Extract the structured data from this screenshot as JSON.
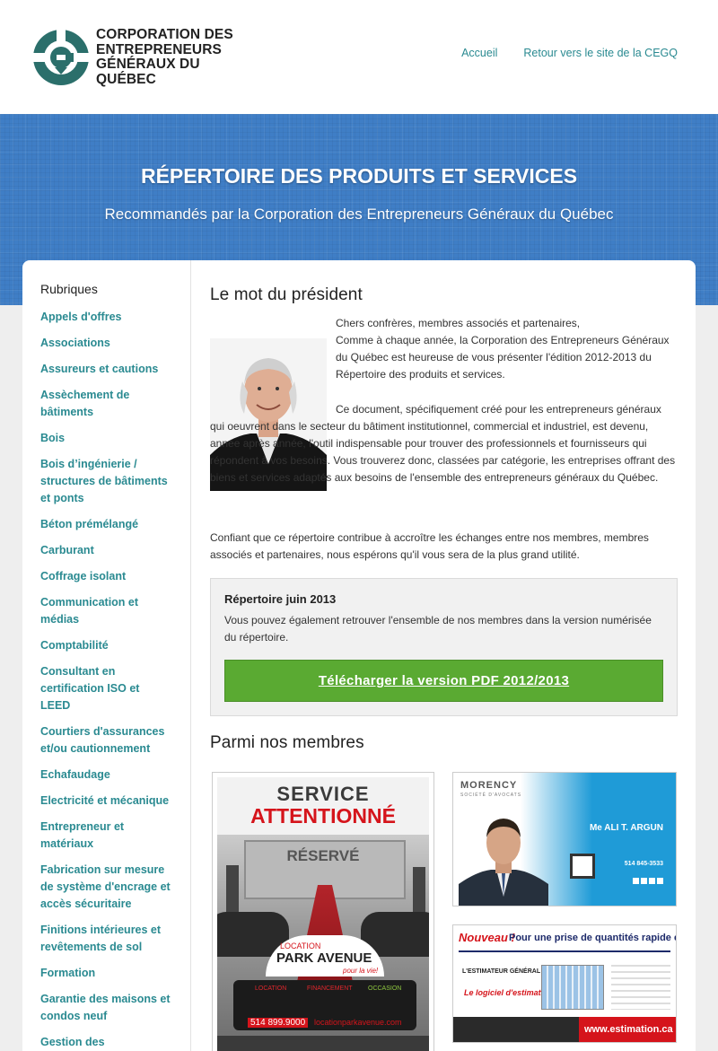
{
  "header": {
    "logo_lines": [
      "CORPORATION DES",
      "ENTREPRENEURS",
      "GÉNÉRAUX DU",
      "QUÉBEC"
    ],
    "nav": [
      {
        "label": "Accueil"
      },
      {
        "label": "Retour vers le site de la CEGQ"
      }
    ]
  },
  "banner": {
    "title": "RÉPERTOIRE DES PRODUITS ET SERVICES",
    "subtitle": "Recommandés par la Corporation des Entrepreneurs Généraux du Québec"
  },
  "sidebar": {
    "heading": "Rubriques",
    "items": [
      {
        "label": "Appels d'offres"
      },
      {
        "label": "Associations"
      },
      {
        "label": "Assureurs et cautions"
      },
      {
        "label": "Assèchement de bâtiments"
      },
      {
        "label": "Bois"
      },
      {
        "label": "Bois d’ingénierie / structures de bâtiments et ponts"
      },
      {
        "label": "Béton prémélangé"
      },
      {
        "label": "Carburant"
      },
      {
        "label": "Coffrage isolant"
      },
      {
        "label": "Communication et médias"
      },
      {
        "label": "Comptabilité"
      },
      {
        "label": "Consultant en certification ISO et LEED"
      },
      {
        "label": "Courtiers d'assurances et/ou cautionnement"
      },
      {
        "label": "Echafaudage"
      },
      {
        "label": "Electricité et mécanique"
      },
      {
        "label": "Entrepreneur et matériaux"
      },
      {
        "label": "Fabrication sur mesure de système d'encrage et accès sécuritaire"
      },
      {
        "label": "Finitions intérieures et revêtements de sol"
      },
      {
        "label": "Formation"
      },
      {
        "label": "Garantie des maisons et condos neuf"
      },
      {
        "label": "Gestion des"
      }
    ]
  },
  "main": {
    "president_title": "Le mot du président",
    "intro_lines": [
      "Chers confrères, membres associés et partenaires,",
      "Comme à chaque année, la Corporation des Entrepreneurs Généraux du Québec est heureuse de vous présenter l'édition 2012-2013 du Répertoire des produits et services."
    ],
    "body_text": "Ce document, spécifiquement créé pour les entrepreneurs généraux qui oeuvrent dans le secteur du bâtiment institutionnel, commercial et industriel, est devenu, année après année, l'outil indispensable pour trouver des professionnels et fournisseurs qui répondent à vos besoins. Vous trouverez donc, classées par catégorie, les entreprises offrant des biens et services adaptés aux besoins de l'ensemble des entrepreneurs généraux du Québec.",
    "closing_text": "Confiant que ce répertoire contribue à accroître les échanges entre nos membres, membres associés et partenaires, nous espérons qu'il vous sera de la plus grand utilité.",
    "download_box": {
      "title": "Répertoire juin 2013",
      "text": "Vous pouvez également retrouver l'ensemble de nos membres dans la version numérisée du répertoire.",
      "button": "Télécharger la version PDF 2012/2013"
    },
    "members_title": "Parmi nos membres",
    "ads": {
      "ad1": {
        "headline1": "SERVICE",
        "headline2": "ATTENTIONNÉ",
        "sign": "RÉSERVÉ",
        "brand_top": "LOCATION",
        "brand": "PARK AVENUE",
        "tagline": "pour la vie!",
        "features": [
          "LOCATION",
          "FINANCEMENT",
          "OCCASION"
        ],
        "phone": "514 899.9000",
        "site": "locationparkavenue.com"
      },
      "ad2": {
        "brand": "MORENCY",
        "brand_sub": "SOCIÉTÉ D'AVOCATS",
        "name": "Me ALI T. ARGUN",
        "phone": "514 845-3533"
      },
      "ad3": {
        "nouveau": "Nouveau !",
        "headline": "Pour une prise de quantités rapide et précise",
        "brand": "L'ESTIMATEUR GÉNÉRAL",
        "subtitle": "Le logiciel d'estimation",
        "site": "www.estimation.ca"
      }
    }
  },
  "colors": {
    "accent": "#2a8a91",
    "banner": "#3f7ec6",
    "button": "#5aaa32"
  }
}
